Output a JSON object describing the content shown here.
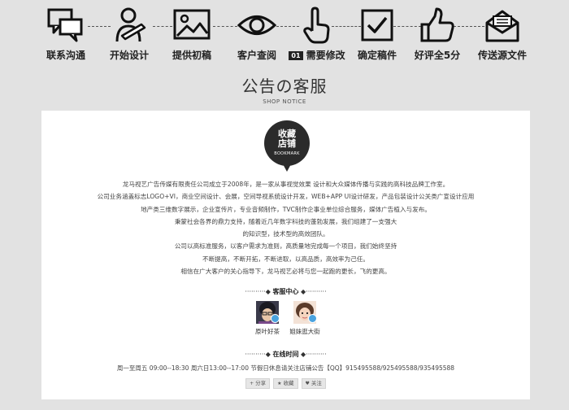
{
  "steps": [
    {
      "label": "联系沟通",
      "icon": "chat-bubbles-icon"
    },
    {
      "label": "开始设计",
      "icon": "designer-pen-icon"
    },
    {
      "label": "提供初稿",
      "icon": "picture-draft-icon"
    },
    {
      "label": "客户查阅",
      "icon": "eye-icon"
    },
    {
      "label": "需要修改",
      "icon": "pointing-hand-icon",
      "badge": "01"
    },
    {
      "label": "确定稿件",
      "icon": "checkbox-icon"
    },
    {
      "label": "好评全5分",
      "icon": "thumbs-up-icon"
    },
    {
      "label": "传送源文件",
      "icon": "envelope-icon"
    }
  ],
  "heading": {
    "title": "公告の客服",
    "subtitle": "SHOP NOTICE"
  },
  "badge": {
    "line1": "收藏",
    "line2": "店铺",
    "en": "BOOKMARK"
  },
  "intro": [
    "龙马视艺广告传媒有限责任公司成立于2008年，是一家从事视觉效果 设计和大众媒体传播与实践的高科技品牌工作室。",
    "公司业务涵盖标志LOGO+VI，商业空间设计、会展，空间导视系统设计开发，WEB+APP UI设计研发，产品包装设计公关类广宣设计应用",
    "地产类三维数字展示，企业宣传片，专业音频制作，TVC制作企事业单位综合服务，媒体广告植入与发布。",
    "秉蒙社会各界的鼎力支持，随着近几年数字科技的蓬勃发展，我们组建了一支强大",
    "的知识型，技术型的高效团队。",
    "公司以高标准服务，以客户需求为准则，高质量地完成每一个项目，我们始终坚持",
    "不断提高，不断开拓，不断进取，以高品质，高效率为己任。",
    "相信在广大客户的关心指导下，龙马视艺必将与您一起跑的更长，飞的更高。"
  ],
  "service": {
    "heading": "客服中心",
    "agents": [
      {
        "name": "原叶好茶"
      },
      {
        "name": "姐妹逛大街"
      }
    ]
  },
  "online": {
    "heading": "在线时间",
    "hours": "周一至周五 09:00--18:30 周六日13:00--17:00 节假日休息请关注店铺公告【QQ】915495588/925495588/935495588"
  },
  "share": [
    {
      "label": "分享",
      "icon": "plus-icon"
    },
    {
      "label": "收藏",
      "icon": "star-icon"
    },
    {
      "label": "关注",
      "icon": "heart-icon"
    }
  ],
  "colors": {
    "background": "#e2e2e2",
    "panel": "#ffffff",
    "dark": "#2b2b2b",
    "qq_blue": "#4aa3df"
  }
}
